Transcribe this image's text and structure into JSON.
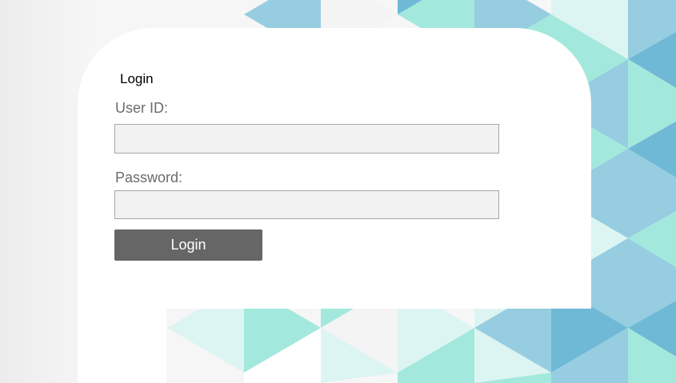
{
  "login": {
    "title": "Login",
    "user_id_label": "User ID:",
    "user_id_value": "",
    "password_label": "Password:",
    "password_value": "",
    "submit_label": "Login"
  },
  "colors": {
    "button_bg": "#666666",
    "field_bg": "#f2f2f2",
    "pattern_blue": "#6fb9d6",
    "pattern_light_blue": "#97cde0",
    "pattern_teal": "#a3e8dd",
    "pattern_pale": "#dcf5f2"
  }
}
